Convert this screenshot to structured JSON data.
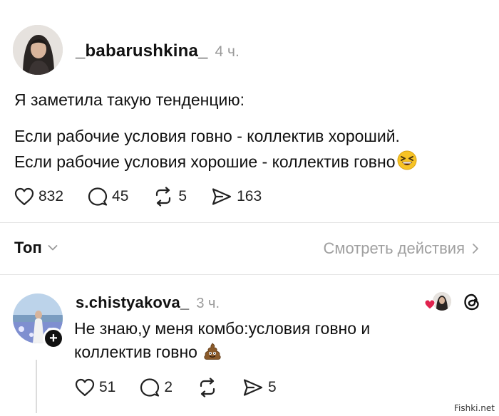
{
  "post": {
    "username": "_babarushkina_",
    "time": "4 ч.",
    "text_line_1": "Я заметила такую тенденцию:",
    "text_line_2": "Если рабочие условия говно - коллектив хороший.",
    "text_line_3": "Если рабочие условия хорошие - коллектив говно",
    "emoji": "grinning-squinting-face",
    "likes": "832",
    "comments": "45",
    "reposts": "5",
    "shares": "163"
  },
  "sort_bar": {
    "label": "Топ",
    "view_activity": "Смотреть действия"
  },
  "reply": {
    "username": "s.chistyakova_",
    "time": "3 ч.",
    "text_line_1": "Не знаю,у меня комбо:условия говно и",
    "text_line_2": "коллектив говно",
    "emoji": "pile-of-poo",
    "likes": "51",
    "comments": "2",
    "shares": "5"
  },
  "watermark": "Fishki.net",
  "colors": {
    "text": "#111111",
    "muted": "#9a9a9a",
    "like_red": "#e0234e",
    "divider": "#e4e4e4"
  }
}
